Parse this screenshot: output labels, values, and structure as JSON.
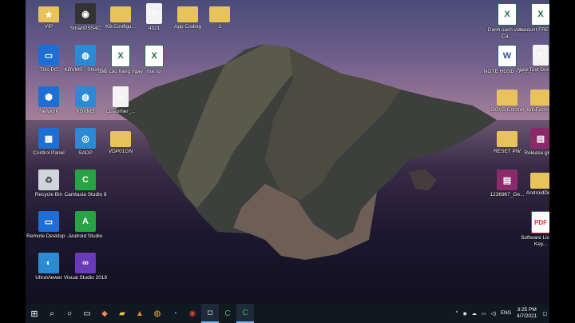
{
  "desktop": {
    "icons": [
      {
        "label": "VIP",
        "glyph": "person-folder-icon",
        "g": "★"
      },
      {
        "label": "SmartPSS4C",
        "glyph": "camera-app-icon",
        "g": "◉"
      },
      {
        "label": "K8-Configu...",
        "glyph": "folder-icon",
        "g": ""
      },
      {
        "label": "4321",
        "glyph": "document-icon",
        "g": "≡"
      },
      {
        "label": "App Coding",
        "glyph": "folder-icon",
        "g": ""
      },
      {
        "label": "1",
        "glyph": "folder-icon",
        "g": ""
      },
      {
        "label": "This PC",
        "glyph": "pc-icon",
        "g": "▭"
      },
      {
        "label": "KBVMS - Shortcut",
        "glyph": "kbvms-icon",
        "g": "◍"
      },
      {
        "label": "Bao cao hang ngay",
        "glyph": "excel-icon",
        "g": "X"
      },
      {
        "label": "ma sp",
        "glyph": "excel-icon",
        "g": "X"
      },
      {
        "label": "Network",
        "glyph": "network-icon",
        "g": "⬢"
      },
      {
        "label": "KBVMS",
        "glyph": "kbvms-icon",
        "g": "◍"
      },
      {
        "label": "Customer_...",
        "glyph": "document-icon",
        "g": "≡"
      },
      {
        "label": "Control Panel",
        "glyph": "control-panel-icon",
        "g": "▦"
      },
      {
        "label": "SADP",
        "glyph": "sadp-icon",
        "g": "◎"
      },
      {
        "label": "VDP01GN",
        "glyph": "folder-icon",
        "g": ""
      },
      {
        "label": "Recycle Bin",
        "glyph": "recycle-bin-icon",
        "g": "♻"
      },
      {
        "label": "Camtasia Studio 8",
        "glyph": "camtasia-icon",
        "g": "C"
      },
      {
        "label": "Remote Desktop ...",
        "glyph": "remote-desktop-icon",
        "g": "▭"
      },
      {
        "label": "Android Studio",
        "glyph": "android-studio-icon",
        "g": "A"
      },
      {
        "label": "UltraViewer",
        "glyph": "ultraviewer-icon",
        "g": "◐"
      },
      {
        "label": "Visual Studio 2019",
        "glyph": "visual-studio-icon",
        "g": "∞"
      },
      {
        "label": "Danh sach video Ca...",
        "glyph": "excel-icon",
        "g": "X"
      },
      {
        "label": "Account FRESHPN",
        "glyph": "excel-icon",
        "g": "X"
      },
      {
        "label": "NOTE HDSD - PH...",
        "glyph": "word-icon",
        "g": "W"
      },
      {
        "label": "New Text Document",
        "glyph": "text-document-icon",
        "g": "≡"
      },
      {
        "label": "OOVS Control",
        "glyph": "folder-icon",
        "g": ""
      },
      {
        "label": "WinForms...",
        "glyph": "folder-icon",
        "g": ""
      },
      {
        "label": "RESET PW",
        "glyph": "folder-icon",
        "g": ""
      },
      {
        "label": "Release.gits...",
        "glyph": "winrar-icon",
        "g": "▤"
      },
      {
        "label": "1236967_Ge...",
        "glyph": "winrar-icon",
        "g": "▤"
      },
      {
        "label": "AndroidDe...",
        "glyph": "folder-icon",
        "g": ""
      },
      {
        "label": "Software License Key...",
        "glyph": "pdf-icon",
        "g": "PDF"
      }
    ]
  },
  "taskbar": {
    "start": "windows-start-icon",
    "items": [
      "search",
      "cortana",
      "task-view",
      "paint",
      "file-explorer",
      "vlc",
      "chrome-dev",
      "edge",
      "chrome",
      "camera",
      "camtasia",
      "camtasia-recorder"
    ],
    "tray": {
      "lang": "ENG",
      "time": "3:25 PM",
      "date": "4/7/2021"
    }
  }
}
